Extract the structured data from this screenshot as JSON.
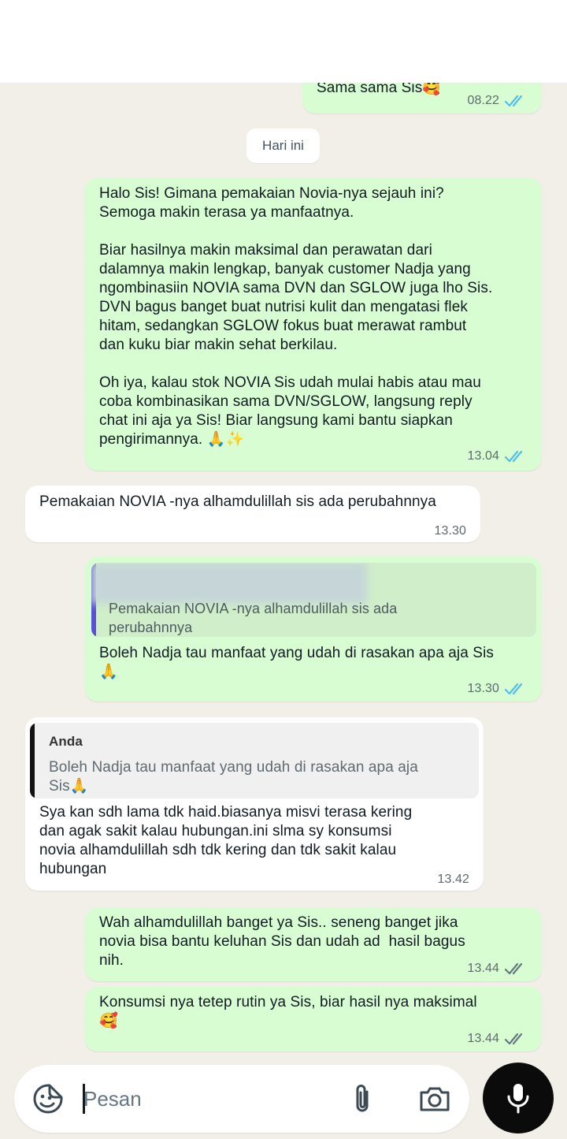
{
  "header": {
    "back_icon": "arrow-back-icon",
    "add_call_icon": "phone-add-icon",
    "menu_icon": "more-vertical-icon"
  },
  "date_divider": "Hari ini",
  "messages": [
    {
      "direction": "out",
      "text": "Sama sama Sis🥰",
      "time": "08.22",
      "status": "read"
    },
    {
      "direction": "out",
      "text": "Halo Sis! Gimana pemakaian Novia-nya sejauh ini?\nSemoga makin terasa ya manfaatnya.\n\nBiar hasilnya makin maksimal dan perawatan dari\ndalamnya makin lengkap, banyak customer Nadja yang\nngombinasiin NOVIA sama DVN dan SGLOW juga lho Sis.\nDVN bagus banget buat nutrisi kulit dan mengatasi flek\nhitam, sedangkan SGLOW fokus buat merawat rambut\ndan kuku biar makin sehat berkilau.\n\nOh iya, kalau stok NOVIA Sis udah mulai habis atau mau\ncoba kombinasikan sama DVN/SGLOW, langsung reply\nchat ini aja ya Sis! Biar langsung kami bantu siapkan\npengirimannya. 🙏✨",
      "time": "13.04",
      "status": "read"
    },
    {
      "direction": "in",
      "text": "Pemakaian NOVIA -nya alhamdulillah sis ada perubahnnya",
      "time": "13.30"
    },
    {
      "direction": "out",
      "quote_text": "Pemakaian NOVIA -nya alhamdulillah sis ada\nperubahnnya",
      "text": "Boleh Nadja tau manfaat yang udah di rasakan apa aja Sis\n🙏",
      "time": "13.30",
      "status": "read"
    },
    {
      "direction": "in",
      "quote_author": "Anda",
      "quote_text": "Boleh Nadja tau manfaat yang udah di rasakan apa aja\nSis🙏",
      "text": "Sya kan sdh lama tdk haid.biasanya misvi terasa kering\ndan agak sakit kalau hubungan.ini slma sy konsumsi\nnovia alhamdulillah sdh tdk kering dan tdk sakit kalau\nhubungan",
      "time": "13.42"
    },
    {
      "direction": "out",
      "text": "Wah alhamdulillah banget ya Sis.. seneng banget jika\nnovia bisa bantu keluhan Sis dan udah ad  hasil bagus\nnih.",
      "time": "13.44",
      "status": "delivered"
    },
    {
      "direction": "out",
      "text": "Konsumsi nya tetep rutin ya Sis, biar hasil nya maksimal\n🥰",
      "time": "13.44",
      "status": "delivered"
    }
  ],
  "composer": {
    "placeholder": "Pesan",
    "sticker_icon": "sticker-icon",
    "attach_icon": "paperclip-icon",
    "camera_icon": "camera-icon",
    "mic_icon": "microphone-icon"
  },
  "colors": {
    "chat_background": "#f2efe8",
    "outgoing_bubble": "#d9fdd3",
    "incoming_bubble": "#ffffff",
    "read_tick": "#53bdeb",
    "delivered_tick": "#667781",
    "reply_bar_out": "#5b4fd6",
    "reply_bar_in": "#111111"
  }
}
